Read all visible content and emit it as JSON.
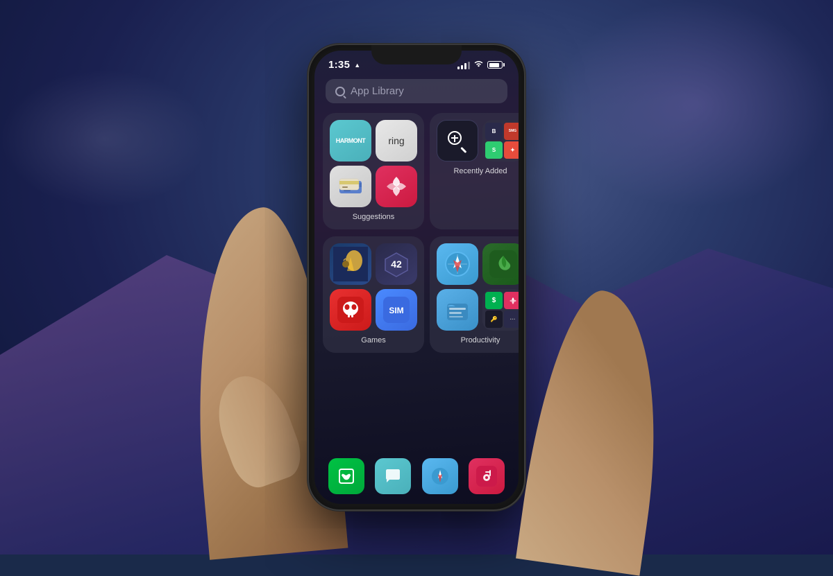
{
  "background": {
    "color1": "#1a2a4a",
    "color2": "#4a3a7a"
  },
  "phone": {
    "statusBar": {
      "time": "1:35",
      "locationArrow": "▲",
      "signalBars": [
        3,
        5,
        7,
        9,
        11
      ],
      "wifi": "wifi",
      "battery": "battery"
    },
    "searchBar": {
      "placeholder": "App Library",
      "icon": "search"
    },
    "categories": [
      {
        "id": "suggestions",
        "label": "Suggestions",
        "largeApps": [
          {
            "name": "Harmony",
            "shortName": "HARMONT",
            "colorClass": "app-harmony"
          },
          {
            "name": "Ring",
            "shortName": "ring",
            "colorClass": "app-ring"
          }
        ],
        "gridApps": [
          {
            "name": "Wallet",
            "colorClass": "app-wallet",
            "letter": "≡"
          },
          {
            "name": "Nova",
            "colorClass": "app-nova",
            "letter": "✦"
          }
        ]
      },
      {
        "id": "recently-added",
        "label": "Recently Added",
        "largeApps": [
          {
            "name": "Search+",
            "shortName": "⊕",
            "colorClass": "app-search"
          }
        ],
        "gridApps": [
          {
            "name": "App B",
            "colorClass": "app-search",
            "letter": "B"
          },
          {
            "name": "App S",
            "colorClass": "app-nova",
            "letter": "S"
          },
          {
            "name": "App M",
            "colorClass": "app-harmony",
            "letter": "M"
          },
          {
            "name": "App G",
            "colorClass": "app-cashapp",
            "letter": "G"
          }
        ]
      },
      {
        "id": "games",
        "label": "Games",
        "largeApps": [
          {
            "name": "Final Fantasy",
            "shortName": "⚔",
            "colorClass": "app-game1"
          },
          {
            "name": "Dice Game",
            "shortName": "42",
            "colorClass": "app-dice"
          }
        ],
        "gridApps": [
          {
            "name": "Skull",
            "colorClass": "app-skull",
            "letter": "☠"
          },
          {
            "name": "Sim",
            "colorClass": "app-sim",
            "letter": "SIM"
          }
        ]
      },
      {
        "id": "productivity",
        "label": "Productivity",
        "largeApps": [
          {
            "name": "Safari",
            "shortName": "◎",
            "colorClass": "app-safari"
          },
          {
            "name": "Mint",
            "shortName": "🌿",
            "colorClass": "app-mint"
          }
        ],
        "gridApps": [
          {
            "name": "Files",
            "colorClass": "app-files",
            "letter": "📁"
          },
          {
            "name": "Dollar",
            "colorClass": "app-cashapp",
            "letter": "$"
          },
          {
            "name": "Nova2",
            "colorClass": "app-nova",
            "letter": "✦"
          },
          {
            "name": "Pass",
            "colorClass": "app-search",
            "letter": "🔑"
          }
        ]
      }
    ],
    "dock": {
      "apps": [
        {
          "name": "Phone",
          "colorClass": "app-cashapp"
        },
        {
          "name": "Messages",
          "colorClass": "app-harmony"
        },
        {
          "name": "Safari",
          "colorClass": "app-safari"
        },
        {
          "name": "Music",
          "colorClass": "app-nova"
        }
      ]
    }
  }
}
